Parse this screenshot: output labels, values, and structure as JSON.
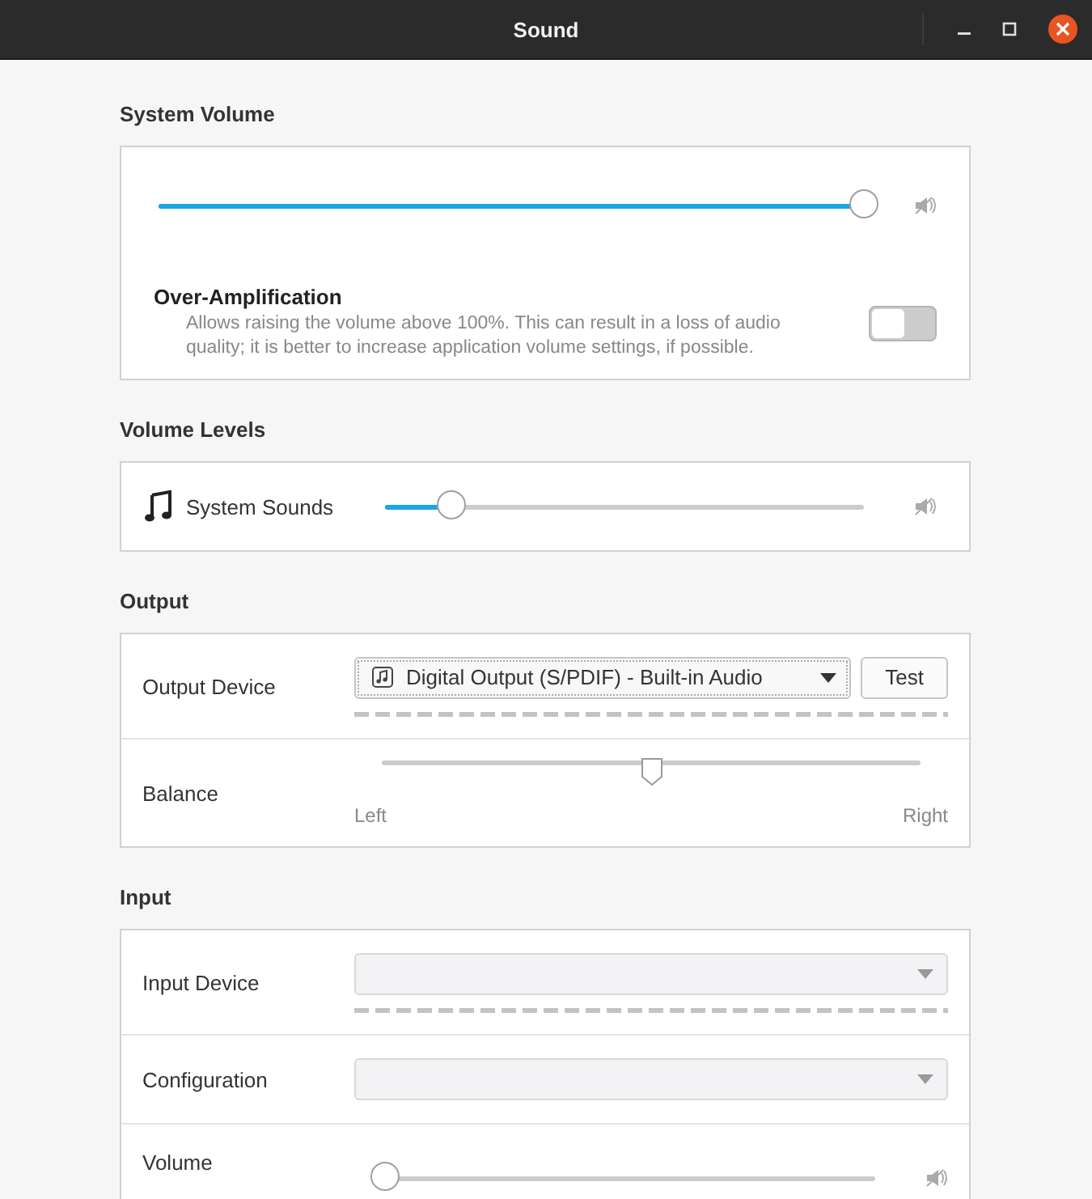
{
  "window": {
    "title": "Sound"
  },
  "system_volume": {
    "heading": "System Volume",
    "level": 1.0,
    "over_amplification": {
      "title": "Over-Amplification",
      "description": "Allows raising the volume above 100%. This can result in a loss of audio quality; it is better to increase application volume settings, if possible.",
      "on": false
    }
  },
  "volume_levels": {
    "heading": "Volume Levels",
    "items": [
      {
        "label": "System Sounds",
        "level": 0.14
      }
    ]
  },
  "output": {
    "heading": "Output",
    "device": {
      "label": "Output Device",
      "value": "Digital Output (S/PDIF) - Built-in Audio",
      "button": "Test"
    },
    "balance": {
      "label": "Balance",
      "level": 0.5,
      "left": "Left",
      "right": "Right"
    }
  },
  "input": {
    "heading": "Input",
    "device": {
      "label": "Input Device"
    },
    "configuration": {
      "label": "Configuration"
    },
    "volume": {
      "label": "Volume",
      "level": 0.0
    }
  }
}
